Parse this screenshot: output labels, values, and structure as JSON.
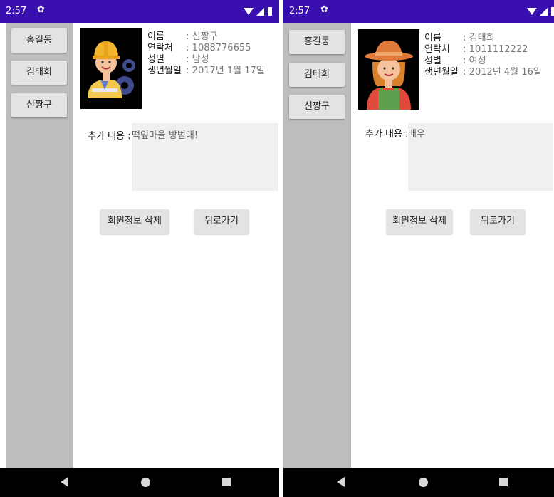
{
  "colors": {
    "status_bar": "#3a0fb0",
    "sidebar": "#bdbdbd",
    "button": "#e3e3e3",
    "memo_box": "#f0f0f0",
    "nav_bar": "#000000"
  },
  "screens": [
    {
      "status": {
        "time": "2:57"
      },
      "members": [
        {
          "label": "홍길동"
        },
        {
          "label": "김태희"
        },
        {
          "label": "신짱구"
        }
      ],
      "detail": {
        "avatar_icon": "construction-worker-avatar",
        "name_label": "이름",
        "name_value": "신짱구",
        "contact_label": "연락처",
        "contact_value": "1088776655",
        "gender_label": "성별",
        "gender_value": "남성",
        "birth_label": "생년월일",
        "birth_value": "2017년 1월 17일",
        "separator": ":",
        "memo_label": "추가 내용 :",
        "memo_value": "떡잎마을 방범대!"
      },
      "actions": {
        "delete_label": "회원정보 삭제",
        "back_label": "뒤로가기"
      }
    },
    {
      "status": {
        "time": "2:57"
      },
      "members": [
        {
          "label": "홍길동"
        },
        {
          "label": "김태희"
        },
        {
          "label": "신짱구"
        }
      ],
      "detail": {
        "avatar_icon": "farmer-woman-avatar",
        "name_label": "이름",
        "name_value": "김태희",
        "contact_label": "연락처",
        "contact_value": "1011112222",
        "gender_label": "성별",
        "gender_value": "여성",
        "birth_label": "생년월일",
        "birth_value": "2012년 4월 16일",
        "separator": ":",
        "memo_label": "추가 내용 :",
        "memo_value": "배우"
      },
      "actions": {
        "delete_label": "회원정보 삭제",
        "back_label": "뒤로가기"
      }
    }
  ]
}
